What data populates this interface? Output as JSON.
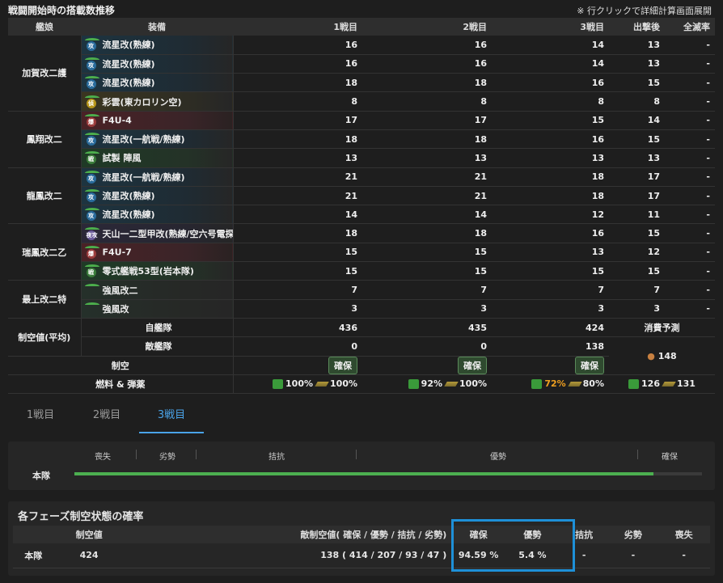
{
  "header": {
    "title": "戦闘開始時の搭載数推移",
    "note": "※ 行クリックで詳細計算画面展開"
  },
  "table": {
    "columns": [
      "艦娘",
      "装備",
      "1戦目",
      "2戦目",
      "3戦目",
      "出撃後",
      "全滅率"
    ],
    "ships": [
      {
        "name": "加賀改二護",
        "rows": [
          {
            "equip": "流星改(熟練)",
            "cat": "攻",
            "color": "blue",
            "v": [
              "16",
              "16",
              "14",
              "13",
              "-"
            ]
          },
          {
            "equip": "流星改(熟練)",
            "cat": "攻",
            "color": "blue",
            "v": [
              "16",
              "16",
              "14",
              "13",
              "-"
            ]
          },
          {
            "equip": "流星改(熟練)",
            "cat": "攻",
            "color": "blue",
            "v": [
              "18",
              "18",
              "16",
              "15",
              "-"
            ]
          },
          {
            "equip": "彩雲(東カロリン空)",
            "cat": "偵",
            "color": "yellow",
            "v": [
              "8",
              "8",
              "8",
              "8",
              "-"
            ]
          }
        ]
      },
      {
        "name": "鳳翔改二",
        "rows": [
          {
            "equip": "F4U-4",
            "cat": "爆",
            "color": "red",
            "v": [
              "17",
              "17",
              "15",
              "14",
              "-"
            ]
          },
          {
            "equip": "流星改(一航戦/熟練)",
            "cat": "攻",
            "color": "blue",
            "v": [
              "18",
              "18",
              "16",
              "15",
              "-"
            ]
          },
          {
            "equip": "試製 陣風",
            "cat": "戦",
            "color": "green",
            "v": [
              "13",
              "13",
              "13",
              "13",
              "-"
            ]
          }
        ]
      },
      {
        "name": "龍鳳改二",
        "rows": [
          {
            "equip": "流星改(一航戦/熟練)",
            "cat": "攻",
            "color": "blue",
            "v": [
              "21",
              "21",
              "18",
              "17",
              "-"
            ]
          },
          {
            "equip": "流星改(熟練)",
            "cat": "攻",
            "color": "blue",
            "v": [
              "21",
              "21",
              "18",
              "17",
              "-"
            ]
          },
          {
            "equip": "流星改(熟練)",
            "cat": "攻",
            "color": "blue",
            "v": [
              "14",
              "14",
              "12",
              "11",
              "-"
            ]
          }
        ]
      },
      {
        "name": "瑞鳳改二乙",
        "rows": [
          {
            "equip": "天山一二型甲改(熟練/空六号電探...",
            "cat": "夜攻",
            "color": "purple",
            "v": [
              "18",
              "18",
              "16",
              "15",
              "-"
            ]
          },
          {
            "equip": "F4U-7",
            "cat": "爆",
            "color": "red",
            "v": [
              "15",
              "15",
              "13",
              "12",
              "-"
            ]
          },
          {
            "equip": "零式艦戦53型(岩本隊)",
            "cat": "戦",
            "color": "green",
            "v": [
              "15",
              "15",
              "15",
              "15",
              "-"
            ]
          }
        ]
      },
      {
        "name": "最上改二特",
        "rows": [
          {
            "equip": "強風改二",
            "cat": "",
            "color": "grey",
            "v": [
              "7",
              "7",
              "7",
              "7",
              "-"
            ]
          },
          {
            "equip": "強風改",
            "cat": "",
            "color": "grey",
            "v": [
              "3",
              "3",
              "3",
              "3",
              "-"
            ]
          }
        ]
      }
    ],
    "air_label": "制空値(平均)",
    "own_label": "自艦隊",
    "own": [
      "436",
      "435",
      "424"
    ],
    "enemy_label": "敵艦隊",
    "enemy": [
      "0",
      "0",
      "138"
    ],
    "consume_label": "消費予測",
    "consume_value": "148",
    "control_label": "制空",
    "control": [
      "確保",
      "確保",
      "確保"
    ],
    "fuel_label": "燃料 & 弾薬",
    "fuel": [
      {
        "f": "100%",
        "a": "100%"
      },
      {
        "f": "92%",
        "a": "100%"
      },
      {
        "f": "72%",
        "a": "80%"
      }
    ],
    "fuel_total": {
      "f": "126",
      "a": "131"
    }
  },
  "tabs": [
    "1戦目",
    "2戦目",
    "3戦目"
  ],
  "active_tab": 2,
  "bar": {
    "labels": [
      "喪失",
      "劣勢",
      "拮抗",
      "優勢",
      "確保"
    ],
    "row_label": "本隊",
    "fill_fraction": 0.923
  },
  "prob": {
    "title": "各フェーズ制空状態の確率",
    "columns": [
      "",
      "制空値",
      "敵制空値( 確保 / 優勢 / 拮抗 / 劣勢)",
      "確保",
      "優勢",
      "拮抗",
      "劣勢",
      "喪失"
    ],
    "row": [
      "本隊",
      "424",
      "138 ( 414 / 207 / 93 / 47 )",
      "94.59 %",
      "5.4 %",
      "-",
      "-",
      "-"
    ]
  },
  "colors": {
    "accent": "#4aa3e8",
    "highlight": "#1e90d8",
    "bar": "#4caf50"
  }
}
